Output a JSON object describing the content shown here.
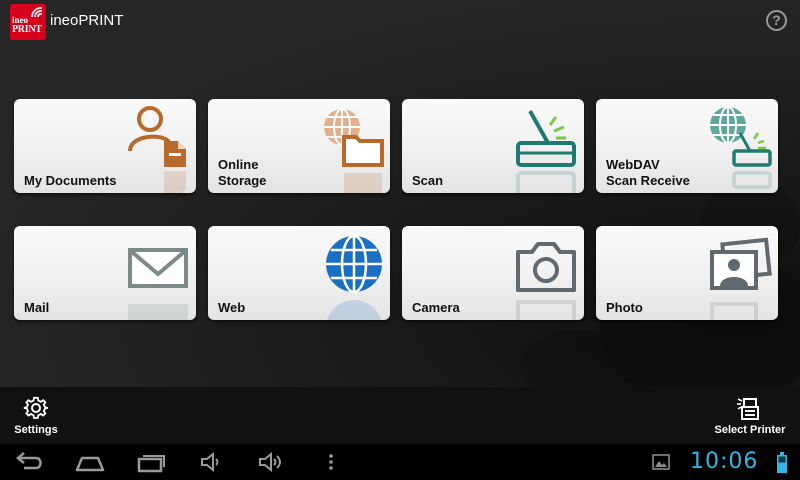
{
  "app": {
    "title": "ineoPRINT",
    "logo_line1": "ineo",
    "logo_line2": "PRINT",
    "help_glyph": "?"
  },
  "tiles": [
    {
      "label": "My Documents",
      "icon": "user-document-icon",
      "color": "#b86a2c"
    },
    {
      "label": "Online\nStorage",
      "icon": "globe-folder-icon",
      "color": "#b86a2c"
    },
    {
      "label": "Scan",
      "icon": "scanner-icon",
      "color": "#1e7a70"
    },
    {
      "label": "WebDAV\nScan Receive",
      "icon": "globe-scanner-icon",
      "color": "#1e7a70"
    },
    {
      "label": "Mail",
      "icon": "envelope-icon",
      "color": "#7d8a8a"
    },
    {
      "label": "Web",
      "icon": "globe-icon",
      "color": "#1a6fc4"
    },
    {
      "label": "Camera",
      "icon": "camera-icon",
      "color": "#606870"
    },
    {
      "label": "Photo",
      "icon": "photo-icon",
      "color": "#606870"
    }
  ],
  "actionbar": {
    "settings_label": "Settings",
    "printer_label": "Select Printer"
  },
  "statusbar": {
    "time": "10:06",
    "accent": "#33b5e5"
  }
}
